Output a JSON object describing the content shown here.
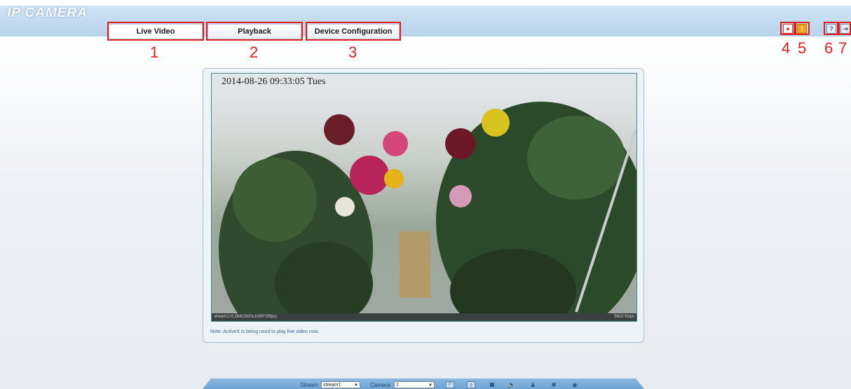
{
  "app": {
    "logo": "IP CAMERA"
  },
  "tabs": [
    {
      "label": "Live Video"
    },
    {
      "label": "Playback"
    },
    {
      "label": "Device Configuration"
    }
  ],
  "callouts": [
    "1",
    "2",
    "3",
    "4",
    "5",
    "6",
    "7"
  ],
  "toolbar_icons": [
    "record-icon",
    "alarm-icon",
    "help-icon",
    "logout-icon"
  ],
  "video": {
    "osd_time": "2014-08-26 09:33:05 Tues",
    "stream_info": "stream1:H.264(1920x1080*25fps)",
    "bitrate": "5610 Kbps"
  },
  "note": "Note: ActiveX is being used to play live video now.",
  "controls": {
    "stream_label": "Stream",
    "stream_value": "stream1",
    "camera_label": "Camera",
    "camera_value": "1",
    "buttons": [
      "ptz-button",
      "lens-button",
      "stop-button",
      "audio-button",
      "intercom-button",
      "settings-button",
      "snapshot-button"
    ]
  },
  "colors": {
    "accent": "#e02020",
    "bar": "#b7d3ec"
  }
}
